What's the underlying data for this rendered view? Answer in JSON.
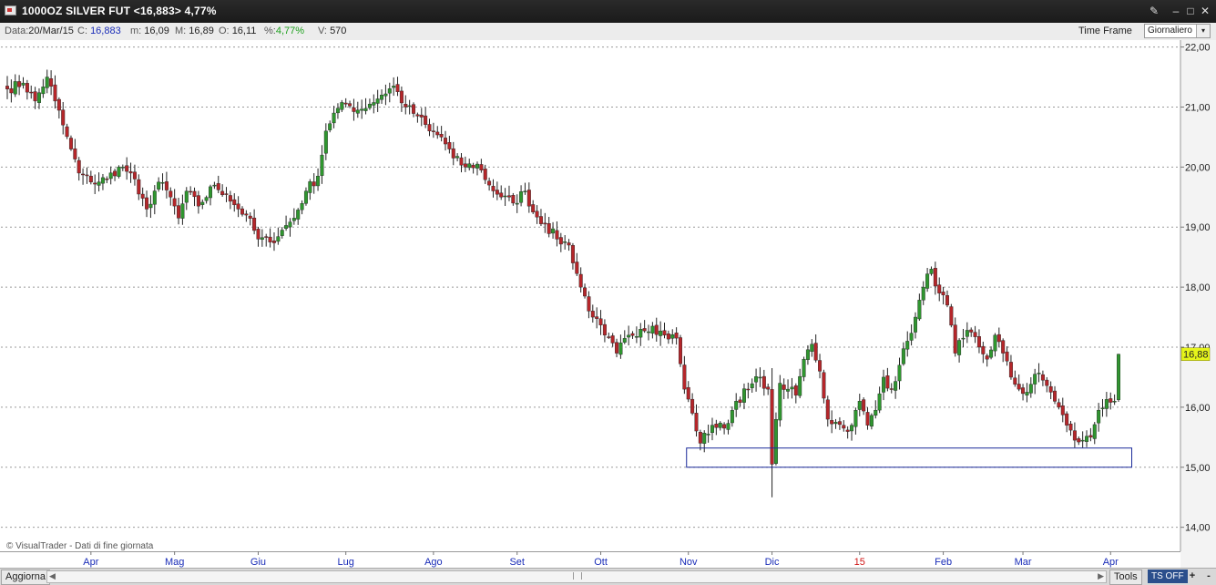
{
  "window": {
    "title": "1000OZ SILVER FUT <16,883> 4,77%",
    "buttons": [
      "✎",
      "–",
      "□",
      "✕"
    ]
  },
  "info": {
    "data_label": "Data:",
    "data_value": "20/Mar/15",
    "c_label": "C:",
    "c_value": "16,883",
    "m_label": "m:",
    "m_value": "16,09",
    "M_label": "M:",
    "M_value": "16,89",
    "o_label": "O:",
    "o_value": "16,11",
    "pct_label": "%:",
    "pct_value": "4,77%",
    "v_label": "V:",
    "v_value": "570",
    "time_frame_label": "Time Frame",
    "time_frame_value": "Giornaliero"
  },
  "chart_data": {
    "type": "candlestick",
    "ylim": [
      13.6,
      22.1
    ],
    "y_ticks": [
      "22,00",
      "21,00",
      "20,00",
      "19,00",
      "18,00",
      "17,00",
      "16,00",
      "15,00",
      "14,00"
    ],
    "y_tick_values": [
      22,
      21,
      20,
      19,
      18,
      17,
      16,
      15,
      14
    ],
    "x_ticks": [
      "Apr",
      "Mag",
      "Giu",
      "Lug",
      "Ago",
      "Set",
      "Ott",
      "Nov",
      "Dic",
      "15",
      "Feb",
      "Mar",
      "Apr"
    ],
    "x_tick_index": [
      21,
      42,
      63,
      85,
      107,
      128,
      149,
      171,
      192,
      214,
      235,
      255,
      277
    ],
    "n_bars": 280,
    "last_price_label": "16,88",
    "last_price": 16.883,
    "watermark": "© VisualTrader - Dati di fine giornata",
    "support_box": {
      "from_index": 171,
      "to_index": 275,
      "low": 15.0,
      "high": 15.32
    },
    "colors": {
      "up": "#2f962f",
      "down": "#b5262a",
      "price_label_bg": "#e6f51a",
      "box": "#1a2a9a"
    },
    "close_anchors": [
      [
        0,
        21.3
      ],
      [
        4,
        21.4
      ],
      [
        7,
        21.1
      ],
      [
        10,
        21.5
      ],
      [
        12,
        21.1
      ],
      [
        14,
        20.7
      ],
      [
        16,
        20.3
      ],
      [
        18,
        19.9
      ],
      [
        21,
        19.75
      ],
      [
        25,
        19.8
      ],
      [
        28,
        20.0
      ],
      [
        31,
        19.9
      ],
      [
        33,
        19.55
      ],
      [
        35,
        19.3
      ],
      [
        38,
        19.75
      ],
      [
        41,
        19.5
      ],
      [
        43,
        19.15
      ],
      [
        45,
        19.6
      ],
      [
        48,
        19.35
      ],
      [
        52,
        19.7
      ],
      [
        55,
        19.55
      ],
      [
        58,
        19.3
      ],
      [
        60,
        19.2
      ],
      [
        63,
        18.8
      ],
      [
        66,
        18.75
      ],
      [
        69,
        18.95
      ],
      [
        72,
        19.15
      ],
      [
        75,
        19.6
      ],
      [
        78,
        19.85
      ],
      [
        80,
        20.6
      ],
      [
        82,
        20.9
      ],
      [
        85,
        21.05
      ],
      [
        88,
        20.95
      ],
      [
        91,
        21.05
      ],
      [
        94,
        21.2
      ],
      [
        97,
        21.35
      ],
      [
        100,
        21.0
      ],
      [
        103,
        20.85
      ],
      [
        106,
        20.6
      ],
      [
        109,
        20.5
      ],
      [
        112,
        20.15
      ],
      [
        115,
        20.0
      ],
      [
        118,
        20.05
      ],
      [
        121,
        19.7
      ],
      [
        124,
        19.5
      ],
      [
        127,
        19.4
      ],
      [
        130,
        19.6
      ],
      [
        132,
        19.25
      ],
      [
        135,
        19.05
      ],
      [
        138,
        18.8
      ],
      [
        141,
        18.7
      ],
      [
        144,
        18.0
      ],
      [
        147,
        17.5
      ],
      [
        150,
        17.2
      ],
      [
        153,
        16.9
      ],
      [
        156,
        17.2
      ],
      [
        159,
        17.3
      ],
      [
        162,
        17.35
      ],
      [
        165,
        17.2
      ],
      [
        168,
        17.15
      ],
      [
        170,
        16.3
      ],
      [
        172,
        15.9
      ],
      [
        174,
        15.4
      ],
      [
        177,
        15.7
      ],
      [
        180,
        15.65
      ],
      [
        183,
        16.1
      ],
      [
        186,
        16.3
      ],
      [
        189,
        16.5
      ],
      [
        191,
        16.3
      ],
      [
        192,
        15.05
      ],
      [
        194,
        16.4
      ],
      [
        196,
        16.3
      ],
      [
        198,
        16.2
      ],
      [
        200,
        16.8
      ],
      [
        202,
        17.05
      ],
      [
        204,
        16.6
      ],
      [
        206,
        15.8
      ],
      [
        208,
        15.75
      ],
      [
        210,
        15.65
      ],
      [
        212,
        15.7
      ],
      [
        214,
        16.1
      ],
      [
        216,
        15.7
      ],
      [
        218,
        15.95
      ],
      [
        220,
        16.5
      ],
      [
        222,
        16.3
      ],
      [
        224,
        16.7
      ],
      [
        226,
        17.1
      ],
      [
        228,
        17.5
      ],
      [
        230,
        18.0
      ],
      [
        232,
        18.3
      ],
      [
        234,
        17.9
      ],
      [
        236,
        17.7
      ],
      [
        238,
        16.9
      ],
      [
        240,
        17.15
      ],
      [
        242,
        17.25
      ],
      [
        244,
        17.0
      ],
      [
        246,
        16.8
      ],
      [
        248,
        17.2
      ],
      [
        250,
        16.9
      ],
      [
        252,
        16.5
      ],
      [
        254,
        16.3
      ],
      [
        256,
        16.25
      ],
      [
        258,
        16.55
      ],
      [
        260,
        16.45
      ],
      [
        262,
        16.25
      ],
      [
        264,
        16.0
      ],
      [
        266,
        15.7
      ],
      [
        268,
        15.45
      ],
      [
        270,
        15.45
      ],
      [
        272,
        15.5
      ],
      [
        274,
        15.95
      ],
      [
        276,
        16.13
      ],
      [
        278,
        16.1
      ],
      [
        279,
        16.883
      ]
    ]
  },
  "bottom": {
    "refresh_label": "Aggiorna",
    "tools_label": "Tools",
    "ts_label": "TS OFF",
    "plus_label": "+",
    "minus_label": "-"
  }
}
